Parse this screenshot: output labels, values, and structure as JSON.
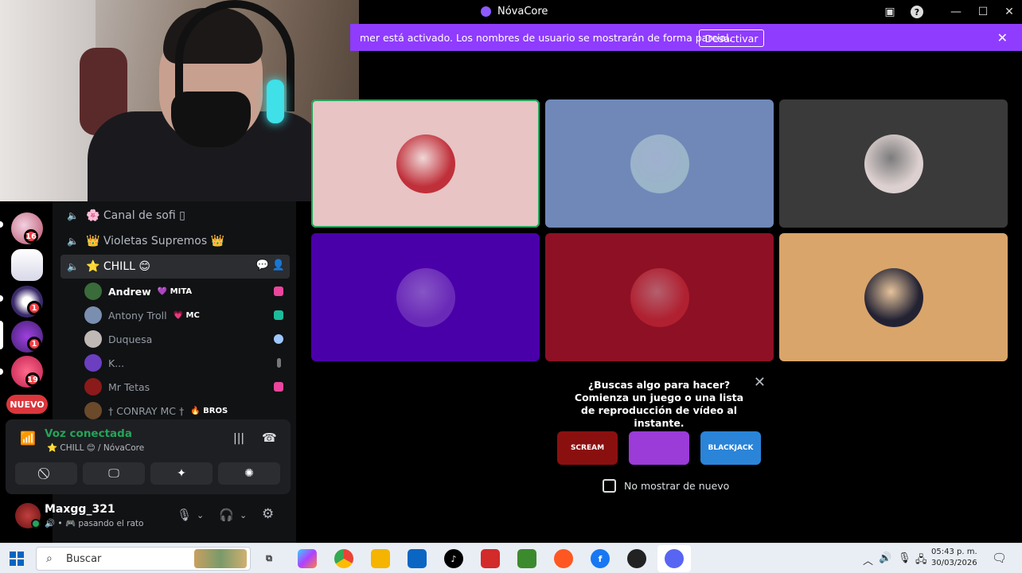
{
  "window": {
    "title": "NóvaCore"
  },
  "banner": {
    "text": "mer está activado. Los nombres de usuario se mostrarán de forma parcial.",
    "button": "Desactivar"
  },
  "rail": {
    "badges": [
      "16",
      "1",
      "1",
      "1",
      "19"
    ],
    "new_label": "NUEVO"
  },
  "channels": [
    {
      "name": "🌸 Canal de sofi ▯"
    },
    {
      "name": "👑 Violetas Supremos 👑"
    },
    {
      "name": "⭐ CHILL 😊"
    }
  ],
  "members": [
    {
      "name": "Andrew",
      "tag": "💜 MITA",
      "avatar_color": "#3a6b3a",
      "status_color": "#eb459e",
      "bold": true
    },
    {
      "name": "Antony Troll",
      "tag": "💗 MC",
      "avatar_color": "#7a8fb0",
      "status_color": "#1abc9c",
      "bold": false
    },
    {
      "name": "Duquesa",
      "tag": "",
      "avatar_color": "#c0b8b5",
      "status_color": "#9ec7ff",
      "bold": false
    },
    {
      "name": "K...",
      "tag": "",
      "avatar_color": "#6b3fc0",
      "status_color": "#777777",
      "bold": false
    },
    {
      "name": "Mr Tetas",
      "tag": "",
      "avatar_color": "#8b1a1a",
      "status_color": "#eb459e",
      "bold": false
    },
    {
      "name": "† CONRAY MC †",
      "tag": "🔥 BROS",
      "avatar_color": "#6a4a2a",
      "status_color": "",
      "bold": false
    }
  ],
  "voice": {
    "title": "Voz conectada",
    "subtitle": "⭐ CHILL 😊 / NóvaCore"
  },
  "user": {
    "name": "Maxgg_321",
    "status": "🔊 • 🎮 pasando el rato"
  },
  "tiles": [
    {
      "bg": "#e8c4c4",
      "avatar": "#c0303a",
      "speaking": true
    },
    {
      "bg": "#7088b8",
      "avatar": "#9ab4c8",
      "speaking": false
    },
    {
      "bg": "#3a3a3a",
      "avatar": "#ddd0d0",
      "speaking": false
    },
    {
      "bg": "#4a00a8",
      "avatar": "#6a2ab8",
      "speaking": false
    },
    {
      "bg": "#8e1025",
      "avatar": "#b02030",
      "speaking": false
    },
    {
      "bg": "#d9a56a",
      "avatar": "#222233",
      "speaking": false
    }
  ],
  "activity": {
    "text": "¿Buscas algo para hacer? Comienza un juego o una lista de reproducción de vídeo al instante.",
    "games": [
      {
        "label": "SCREAM",
        "color": "#8a1010"
      },
      {
        "label": "",
        "color": "#9b3bd8"
      },
      {
        "label": "BLACKJACK",
        "color": "#2a84d8"
      }
    ],
    "checkbox_label": "No mostrar de nuevo"
  },
  "taskbar": {
    "search_placeholder": "Buscar",
    "time": "05:43 p. m.",
    "date": "30/03/2026"
  }
}
